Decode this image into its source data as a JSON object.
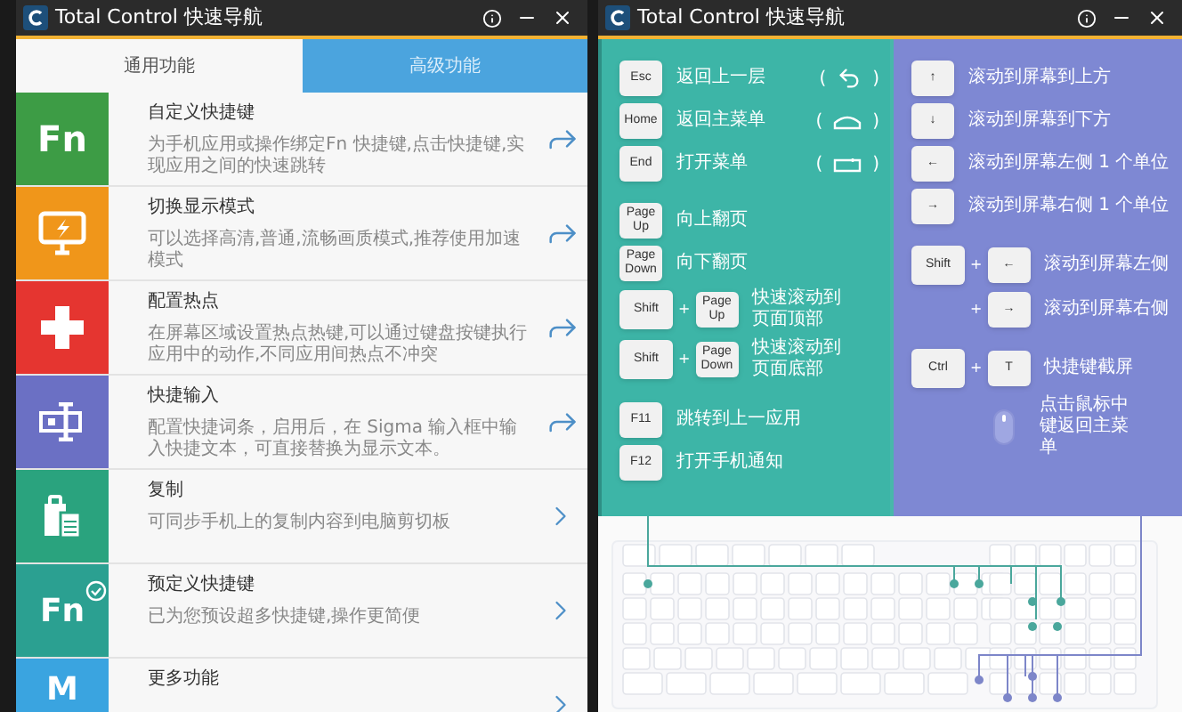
{
  "left_window": {
    "title": "Total Control 快速导航",
    "tabs": [
      {
        "label": "通用功能",
        "selected": true
      },
      {
        "label": "高级功能",
        "selected": false
      }
    ],
    "features": [
      {
        "icon": {
          "kind": "fn",
          "text": "Fn"
        },
        "color": "#3d9c45",
        "title": "自定义快捷键",
        "description": "为手机应用或操作绑定Fn 快捷键,点击快捷键,实现应用之间的快速跳转",
        "action": {
          "kind": "share"
        }
      },
      {
        "icon": {
          "kind": "monitor"
        },
        "color": "#f0961a",
        "title": "切换显示模式",
        "description": "可以选择高清,普通,流畅画质模式,推荐使用加速模式",
        "action": {
          "kind": "share"
        }
      },
      {
        "icon": {
          "kind": "plus"
        },
        "color": "#e53530",
        "title": "配置热点",
        "description": "在屏幕区域设置热点热键,可以通过键盘按键执行应用中的动作,不同应用间热点不冲突",
        "action": {
          "kind": "share"
        }
      },
      {
        "icon": {
          "kind": "text"
        },
        "color": "#6b70c4",
        "title": "快捷输入",
        "description": "配置快捷词条，启用后，在 Sigma 输入框中输入快捷文本，可直接替换为显示文本。",
        "action": {
          "kind": "share"
        }
      },
      {
        "icon": {
          "kind": "clipboard"
        },
        "color": "#2aa37e",
        "title": "复制",
        "description": "可同步手机上的复制内容到电脑剪切板",
        "action": {
          "kind": "chevron"
        }
      },
      {
        "icon": {
          "kind": "check",
          "text": "Fn"
        },
        "color": "#2ba091",
        "title": "预定义快捷键",
        "description": "已为您预设超多快捷键,操作更简便",
        "action": {
          "kind": "chevron"
        }
      },
      {
        "icon": {
          "kind": "letter",
          "text": "M"
        },
        "color": "#3aa4e0",
        "title": "更多功能",
        "action": {
          "kind": "chevron"
        }
      }
    ]
  },
  "right_window": {
    "title": "Total Control 快速导航",
    "left_groups": [
      {
        "shortcuts": [
          {
            "keys": [
              {
                "kind": "key",
                "label": "Esc"
              }
            ],
            "description": "返回上一层",
            "paren_open": "(",
            "glyph": {
              "kind": "back"
            },
            "paren_close": ")"
          },
          {
            "keys": [
              {
                "kind": "key",
                "label": "Home"
              }
            ],
            "description": "返回主菜单",
            "paren_open": "(",
            "glyph": {
              "kind": "home"
            },
            "paren_close": ")"
          },
          {
            "keys": [
              {
                "kind": "key",
                "label": "End"
              }
            ],
            "description": "打开菜单",
            "paren_open": "(",
            "glyph": {
              "kind": "menu"
            },
            "paren_close": ")"
          }
        ]
      },
      {
        "shortcuts": [
          {
            "keys": [
              {
                "kind": "key",
                "label": "Page Up"
              }
            ],
            "description": "向上翻页"
          },
          {
            "keys": [
              {
                "kind": "key",
                "label": "Page Down"
              }
            ],
            "description": "向下翻页"
          },
          {
            "keys": [
              {
                "kind": "wide",
                "label": "Shift"
              },
              {
                "kind": "plus",
                "label": "+"
              },
              {
                "kind": "key",
                "label": "Page Up"
              }
            ],
            "description": "快速滚动到页面顶部"
          },
          {
            "keys": [
              {
                "kind": "wide",
                "label": "Shift"
              },
              {
                "kind": "plus",
                "label": "+"
              },
              {
                "kind": "key",
                "label": "Page Down"
              }
            ],
            "description": "快速滚动到页面底部"
          }
        ]
      },
      {
        "shortcuts": [
          {
            "keys": [
              {
                "kind": "key",
                "label": "F11"
              }
            ],
            "description": "跳转到上一应用"
          },
          {
            "keys": [
              {
                "kind": "key",
                "label": "F12"
              }
            ],
            "description": "打开手机通知"
          }
        ]
      }
    ],
    "right_groups": [
      {
        "shortcuts": [
          {
            "keys": [
              {
                "kind": "key",
                "label": "↑"
              }
            ],
            "description": "滚动到屏幕到上方"
          },
          {
            "keys": [
              {
                "kind": "key",
                "label": "↓"
              }
            ],
            "description": "滚动到屏幕到下方"
          },
          {
            "keys": [
              {
                "kind": "key",
                "label": "←"
              }
            ],
            "description": "滚动到屏幕左侧 1 个单位"
          },
          {
            "keys": [
              {
                "kind": "key",
                "label": "→"
              }
            ],
            "description": "滚动到屏幕右侧 1 个单位"
          }
        ]
      },
      {
        "shortcuts": [
          {
            "keys": [
              {
                "kind": "wide",
                "label": "Shift"
              },
              {
                "kind": "plus",
                "label": "+"
              },
              {
                "kind": "key",
                "label": "←"
              }
            ],
            "description": "滚动到屏幕左侧"
          },
          {
            "keys": [
              {
                "kind": "spacer"
              },
              {
                "kind": "plus",
                "label": "+"
              },
              {
                "kind": "key",
                "label": "→"
              }
            ],
            "description": "滚动到屏幕右侧"
          }
        ]
      },
      {
        "shortcuts": [
          {
            "keys": [
              {
                "kind": "wide",
                "label": "Ctrl"
              },
              {
                "kind": "plus",
                "label": "+"
              },
              {
                "kind": "key",
                "label": "T"
              }
            ],
            "description": "快捷键截屏"
          },
          {
            "keys": [
              {
                "kind": "spacer"
              },
              {
                "kind": "mouse"
              }
            ],
            "description": "点击鼠标中键返回主菜单"
          }
        ]
      }
    ]
  }
}
